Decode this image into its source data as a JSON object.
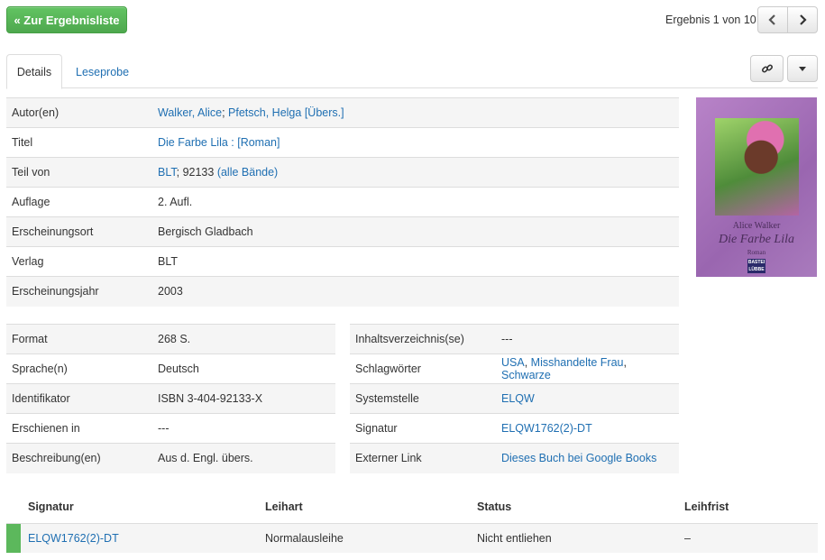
{
  "header": {
    "back_label": "« Zur Ergebnisliste",
    "result_text": "Ergebnis 1 von 10"
  },
  "tabs": [
    {
      "label": "Details",
      "active": true
    },
    {
      "label": "Leseprobe",
      "active": false
    }
  ],
  "icons": {
    "prev": "chevron-left-icon",
    "next": "chevron-right-icon",
    "permalink": "link-icon",
    "more": "caret-down-icon"
  },
  "details": {
    "rows": [
      {
        "label": "Autor(en)",
        "value": "Walker, Alice; Pfetsch, Helga [Übers.]"
      },
      {
        "label": "Titel",
        "value": "Die Farbe Lila : [Roman]"
      },
      {
        "label": "Teil von",
        "value_link": "BLT",
        "value_rest": "; 92133 ",
        "value_link2": "(alle Bände)"
      },
      {
        "label": "Auflage",
        "value": "2. Aufl."
      },
      {
        "label": "Erscheinungsort",
        "value": "Bergisch Gladbach"
      },
      {
        "label": "Verlag",
        "value": "BLT"
      },
      {
        "label": "Erscheinungsjahr",
        "value": "2003"
      }
    ],
    "author1": "Walker, Alice",
    "author_sep": "; ",
    "author2": "Pfetsch, Helga [Übers.]"
  },
  "left_table": [
    {
      "label": "Format",
      "value": "268 S."
    },
    {
      "label": "Sprache(n)",
      "value": "Deutsch"
    },
    {
      "label": "Identifikator",
      "value": "ISBN 3-404-92133-X"
    },
    {
      "label": "Erschienen in",
      "value": "---"
    },
    {
      "label": "Beschreibung(en)",
      "value": "Aus d. Engl. übers."
    }
  ],
  "right_table": {
    "toc_label": "Inhaltsverzeichnis(se)",
    "toc_value": "---",
    "subjects_label": "Schlagwörter",
    "subjects": [
      "USA",
      "Misshandelte Frau",
      "Schwarze"
    ],
    "subject_sep": ", ",
    "class_label": "Systemstelle",
    "class_value": "ELQW",
    "sig_label": "Signatur",
    "sig_value": "ELQW1762(2)-DT",
    "ext_label": "Externer Link",
    "ext_value": "Dieses Buch bei Google Books"
  },
  "cover": {
    "author": "Alice Walker",
    "title": "Die Farbe Lila",
    "subtitle": "Roman",
    "logo": "BASTEI LÜBBE"
  },
  "holdings": {
    "headers": [
      "Signatur",
      "Leihart",
      "Status",
      "Leihfrist"
    ],
    "rows": [
      {
        "signatur": "ELQW1762(2)-DT",
        "leihart": "Normalausleihe",
        "status": "Nicht entliehen",
        "leihfrist": "–",
        "status_color": "#5cb85c"
      }
    ]
  }
}
